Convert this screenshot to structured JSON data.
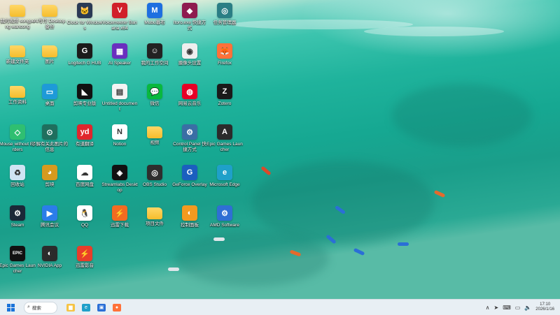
{
  "screen": {
    "title": "Windows desktop"
  },
  "desktop_icons": [
    {
      "label": "我的视频 songpeng wancong",
      "icon": "folder-icon",
      "kind": "folder",
      "color": ""
    },
    {
      "label": "AI写作 Desktop 备份",
      "icon": "folder-icon",
      "kind": "folder",
      "color": ""
    },
    {
      "label": "Clock for Windows",
      "icon": "cat-clock-icon",
      "kind": "app",
      "color": "#2b3a55",
      "glyph": "🐱"
    },
    {
      "label": "Voicemeeter Banana x64",
      "icon": "voicemeeter-icon",
      "kind": "app",
      "color": "#d11f2a",
      "glyph": "V"
    },
    {
      "label": "Mubu幕布",
      "icon": "mubu-icon",
      "kind": "app",
      "color": "#1e6fe0",
      "glyph": "M"
    },
    {
      "label": "Itoro.exe 快捷方式",
      "icon": "itoro-icon",
      "kind": "app",
      "color": "#8e1b4f",
      "glyph": "◆"
    },
    {
      "label": "任务管理器",
      "icon": "monitor-icon",
      "kind": "app",
      "color": "#2a7e85",
      "glyph": "◎"
    },
    {
      "label": "新建文件夹",
      "icon": "folder-icon",
      "kind": "folder",
      "color": ""
    },
    {
      "label": "图片",
      "icon": "user-folder-icon",
      "kind": "folder",
      "color": ""
    },
    {
      "label": "Logitech G HUB",
      "icon": "logitech-icon",
      "kind": "app",
      "color": "#1b1b1b",
      "glyph": "G"
    },
    {
      "label": "AI Speaker",
      "icon": "pixel-app-icon",
      "kind": "app",
      "color": "#6a2fbf",
      "glyph": "▦"
    },
    {
      "label": "我的工作空间",
      "icon": "pixel-face-icon",
      "kind": "app",
      "color": "#222222",
      "glyph": "☺"
    },
    {
      "label": "摄像头设置",
      "icon": "webcam-icon",
      "kind": "app",
      "color": "#eeeeee",
      "glyph": "◉"
    },
    {
      "label": "Firefox",
      "icon": "firefox-icon",
      "kind": "app",
      "color": "#ff7139",
      "glyph": "🦊"
    },
    {
      "label": "工作资料",
      "icon": "folder-icon",
      "kind": "folder",
      "color": ""
    },
    {
      "label": "桌面",
      "icon": "desktop-folder-icon",
      "kind": "app",
      "color": "#1e9ad8",
      "glyph": "▭"
    },
    {
      "label": "剪映专业版",
      "icon": "capcut-icon",
      "kind": "app",
      "color": "#111111",
      "glyph": "◣"
    },
    {
      "label": "Untitled document",
      "icon": "document-icon",
      "kind": "app",
      "color": "#f3f3f3",
      "glyph": "▤"
    },
    {
      "label": "微信",
      "icon": "wechat-icon",
      "kind": "app",
      "color": "#09b83e",
      "glyph": "💬"
    },
    {
      "label": "网易云音乐",
      "icon": "netease-music-icon",
      "kind": "app",
      "color": "#e60026",
      "glyph": "◍"
    },
    {
      "label": "Zotero",
      "icon": "zotero-icon",
      "kind": "app",
      "color": "#1a1a1a",
      "glyph": "Z"
    },
    {
      "label": "Mouse without Borders",
      "icon": "mouse-icon",
      "kind": "app",
      "color": "#2fbf71",
      "glyph": "◇"
    },
    {
      "label": "了解有关此图片的信息",
      "icon": "info-icon",
      "kind": "app",
      "color": "#1f6f5e",
      "glyph": "⊙"
    },
    {
      "label": "有道翻译",
      "icon": "youdao-icon",
      "kind": "app",
      "color": "#e0262d",
      "glyph": "yd"
    },
    {
      "label": "Notion",
      "icon": "notion-icon",
      "kind": "app",
      "color": "#ffffff",
      "glyph": "N"
    },
    {
      "label": "视频",
      "icon": "folder-icon",
      "kind": "folder",
      "color": ""
    },
    {
      "label": "Control Panel 快捷方式",
      "icon": "settings-gear-icon",
      "kind": "app",
      "color": "#3a6ea5",
      "glyph": "⚙"
    },
    {
      "label": "Epic Games Launcher",
      "icon": "unreal-icon",
      "kind": "app",
      "color": "#2b2b2b",
      "glyph": "A"
    },
    {
      "label": "回收站",
      "icon": "recycle-bin-icon",
      "kind": "app",
      "color": "#cfe4f3",
      "glyph": "♻"
    },
    {
      "label": "剪映",
      "icon": "owl-icon",
      "kind": "app",
      "color": "#d69a1e",
      "glyph": "◕"
    },
    {
      "label": "百度网盘",
      "icon": "baidu-netdisk-icon",
      "kind": "app",
      "color": "#ffffff",
      "glyph": "☁"
    },
    {
      "label": "Streamlabs Desktop",
      "icon": "streamlabs-icon",
      "kind": "app",
      "color": "#111111",
      "glyph": "◈"
    },
    {
      "label": "OBS Studio",
      "icon": "obs-icon",
      "kind": "app",
      "color": "#2e2e2e",
      "glyph": "◎"
    },
    {
      "label": "GeForce Overlay",
      "icon": "overlay-icon",
      "kind": "app",
      "color": "#1b5fbf",
      "glyph": "G"
    },
    {
      "label": "Microsoft Edge",
      "icon": "edge-icon",
      "kind": "app",
      "color": "#1fa0c9",
      "glyph": "e"
    },
    {
      "label": "Steam",
      "icon": "steam-icon",
      "kind": "app",
      "color": "#1b2838",
      "glyph": "⚙"
    },
    {
      "label": "腾讯会议",
      "icon": "tencent-meeting-icon",
      "kind": "app",
      "color": "#2b7de9",
      "glyph": "▶"
    },
    {
      "label": "QQ",
      "icon": "qq-icon",
      "kind": "app",
      "color": "#ffffff",
      "glyph": "🐧"
    },
    {
      "label": "迅雷下载",
      "icon": "xunlei-icon",
      "kind": "app",
      "color": "#f26b21",
      "glyph": "⚡"
    },
    {
      "label": "项目文件",
      "icon": "folder-icon",
      "kind": "folder",
      "color": ""
    },
    {
      "label": "控制面板",
      "icon": "control-panel-icon",
      "kind": "app",
      "color": "#f39a1f",
      "glyph": "◐"
    },
    {
      "label": "AMD Software",
      "icon": "gear-app-icon",
      "kind": "app",
      "color": "#2f6fd4",
      "glyph": "⚙"
    },
    {
      "label": "Epic Games Launcher",
      "icon": "epic-games-icon",
      "kind": "app",
      "color": "#111111",
      "glyph": "EPIC"
    },
    {
      "label": "NVIDIA App",
      "icon": "nvidia-icon",
      "kind": "app",
      "color": "#2b2b2b",
      "glyph": "◐"
    },
    {
      "label": "迅雷影音",
      "icon": "xunlei-player-icon",
      "kind": "app",
      "color": "#e83d2a",
      "glyph": "⚡"
    }
  ],
  "taskbar": {
    "start_label": "Start",
    "search_placeholder": "搜索",
    "pinned": [
      {
        "name": "file-explorer-icon",
        "color": "#f6c445",
        "glyph": "▆"
      },
      {
        "name": "edge-taskbar-icon",
        "color": "#1fa0c9",
        "glyph": "e"
      },
      {
        "name": "store-taskbar-icon",
        "color": "#2b6fd6",
        "glyph": "▣"
      },
      {
        "name": "firefox-taskbar-icon",
        "color": "#ff7139",
        "glyph": "●"
      }
    ],
    "tray_icons": [
      "chevron-up-icon",
      "location-icon",
      "keyboard-icon",
      "network-icon",
      "volume-icon"
    ],
    "time": "17:10",
    "date": "2026/1/16"
  },
  "colors": {
    "accent": "#1a73d9",
    "taskbar_bg": "#e8eff4"
  }
}
